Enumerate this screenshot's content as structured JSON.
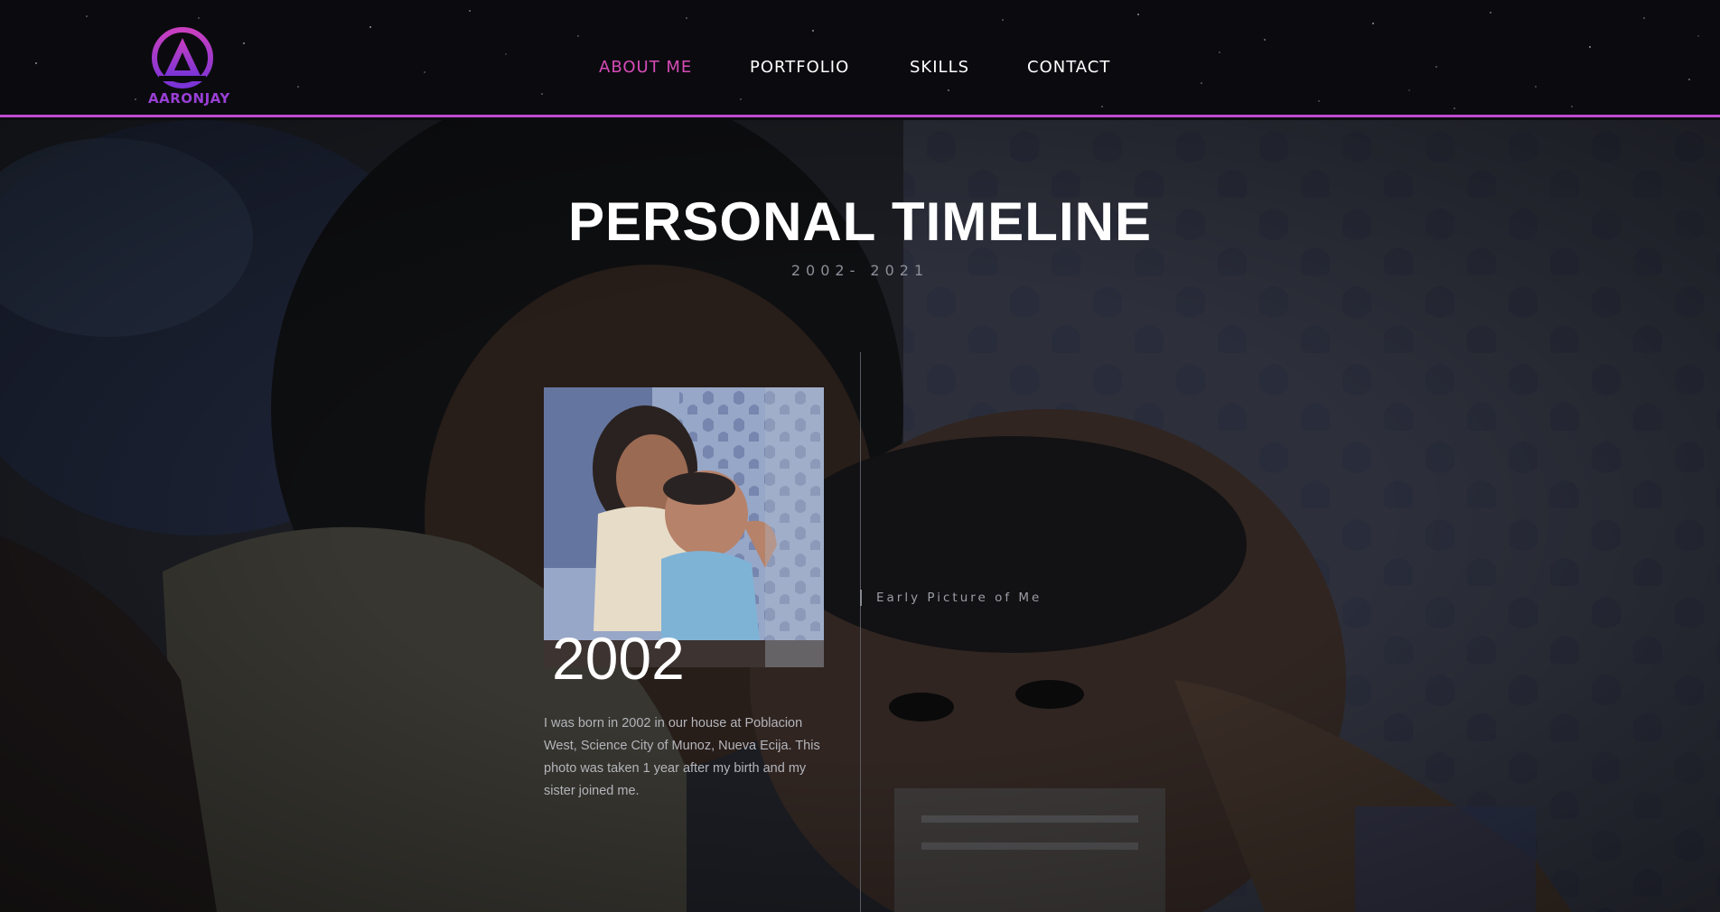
{
  "header": {
    "logo_text": "AARONJAY",
    "nav": [
      {
        "label": "ABOUT ME",
        "active": true
      },
      {
        "label": "PORTFOLIO",
        "active": false
      },
      {
        "label": "SKILLS",
        "active": false
      },
      {
        "label": "CONTACT",
        "active": false
      }
    ]
  },
  "hero": {
    "title": "PERSONAL TIMELINE",
    "subtitle": "2002- 2021"
  },
  "timeline": {
    "entries": [
      {
        "year": "2002",
        "description": "I was born in 2002 in our house at Poblacion West, Science City of Munoz, Nueva Ecija. This photo was taken 1 year after my birth and my sister joined me.",
        "caption": "Early Picture of Me"
      }
    ]
  },
  "colors": {
    "accent": "#d64bb8",
    "accent_purple": "#9a3fd6",
    "header_bg": "#0b0b0f",
    "header_border": "#c04ad0"
  },
  "icons": {
    "logo": "aaronjay-logo-icon"
  }
}
